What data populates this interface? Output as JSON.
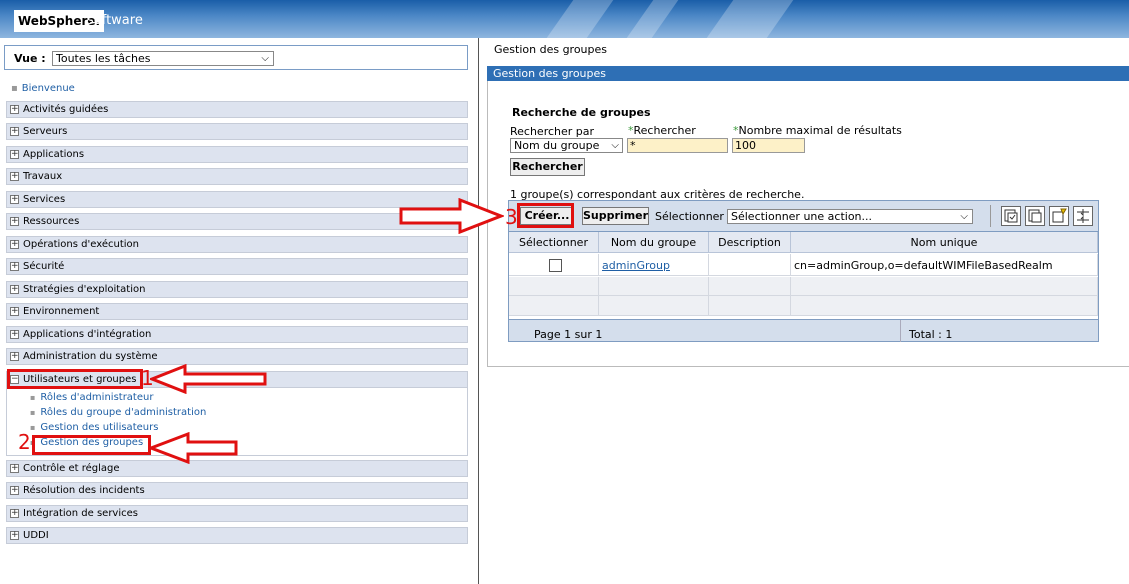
{
  "banner": {
    "logo_brand": "WebSphere.",
    "logo_suffix": "software"
  },
  "view": {
    "label": "Vue :",
    "selected": "Toutes les tâches"
  },
  "nav": {
    "welcome": "Bienvenue",
    "items_top": [
      "Activités guidées",
      "Serveurs",
      "Applications",
      "Travaux",
      "Services",
      "Ressources",
      "Opérations d'exécution",
      "Sécurité",
      "Stratégies d'exploitation",
      "Environnement",
      "Applications d'intégration",
      "Administration du système"
    ],
    "expanded": {
      "label": "Utilisateurs et groupes",
      "children": [
        "Rôles d'administrateur",
        "Rôles du groupe d'administration",
        "Gestion des utilisateurs",
        "Gestion des groupes"
      ]
    },
    "items_bottom": [
      "Contrôle et réglage",
      "Résolution des incidents",
      "Intégration de services",
      "UDDI"
    ]
  },
  "annotations": {
    "step1": "1",
    "step2": "2",
    "step3": "3",
    "color": "#e01010"
  },
  "main": {
    "breadcrumb": "Gestion des groupes",
    "title": "Gestion des groupes",
    "search": {
      "title": "Recherche de groupes",
      "search_by_label": "Rechercher par",
      "search_by_value": "Nom du groupe",
      "search_label": "Rechercher",
      "search_value": "*",
      "max_label": "Nombre maximal de résultats",
      "max_value": "100",
      "button": "Rechercher",
      "required_mark": "*"
    },
    "result_text": "1 groupe(s) correspondant aux critères de recherche.",
    "toolbar": {
      "create": "Créer...",
      "delete": "Supprimer",
      "select_label": "Sélectionner",
      "action_placeholder": "Sélectionner une action..."
    },
    "table": {
      "headers": [
        "Sélectionner",
        "Nom du groupe",
        "Description",
        "Nom unique"
      ],
      "rows": [
        {
          "group_name": "adminGroup",
          "description": "",
          "unique_name": "cn=adminGroup,o=defaultWIMFileBasedRealm"
        }
      ],
      "page_info": "Page 1 sur 1",
      "total_info": "Total : 1"
    }
  },
  "colors": {
    "title_bar": "#2e6fb5",
    "nav_bg": "#dde3ef",
    "link": "#1f5fa5",
    "input_bg": "#fdf1c8"
  }
}
